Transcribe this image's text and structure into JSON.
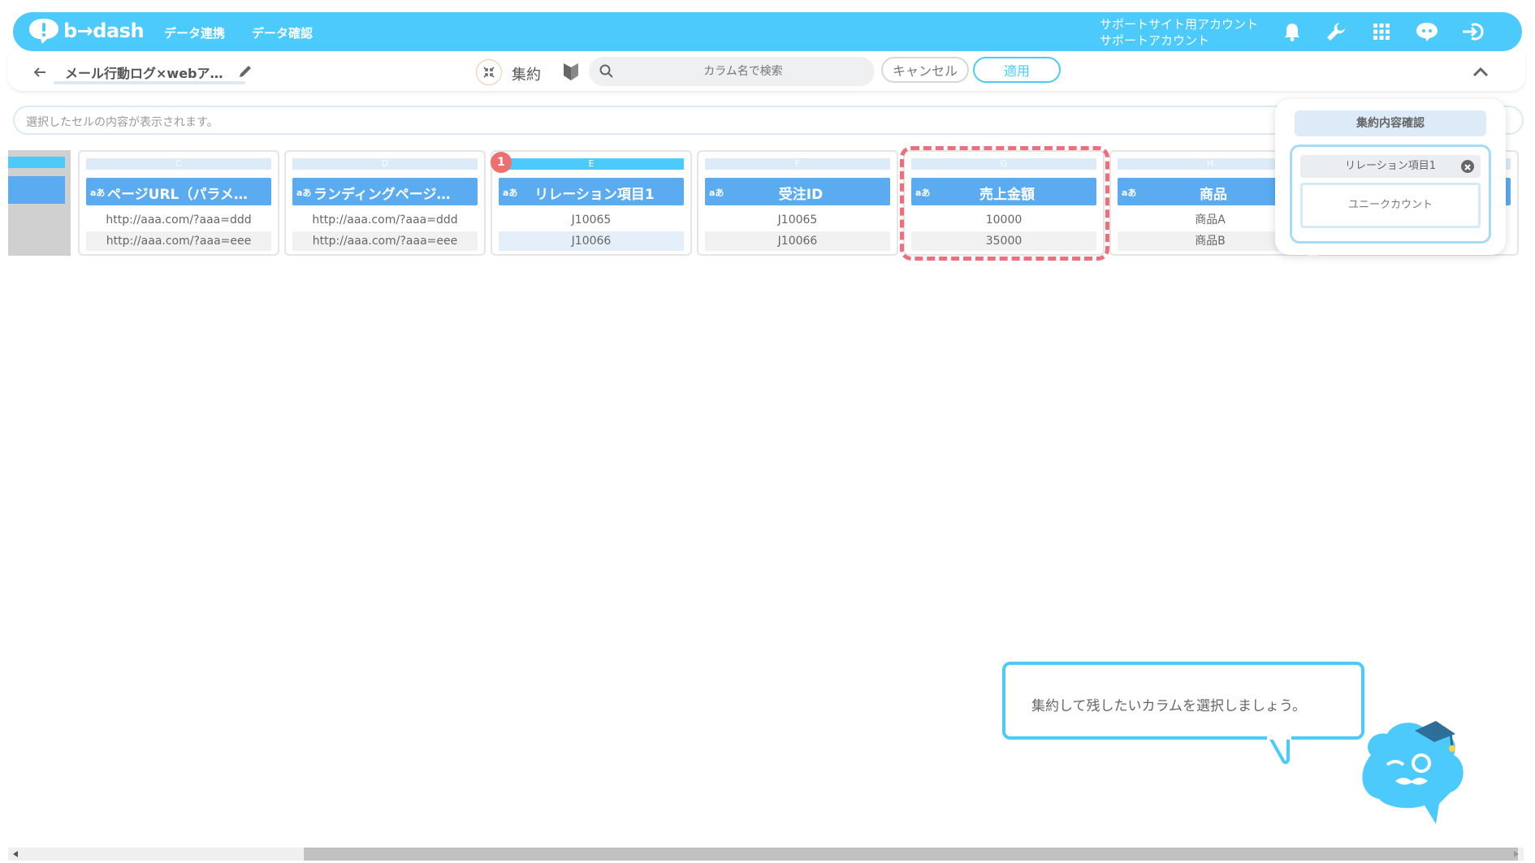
{
  "app": {
    "logo_text": "b→dash",
    "nav": [
      "データ連携",
      "データ確認"
    ],
    "account_line1": "サポートサイト用アカウント",
    "account_line2": "サポートアカウント",
    "icons": [
      "bell-icon",
      "wrench-icon",
      "grid-icon",
      "chat-icon",
      "logout-icon"
    ],
    "accent_color": "#4ccafb"
  },
  "toolbar": {
    "doc_title": "メール行動ログ×webア…",
    "agg_label": "集約",
    "search_placeholder": "カラム名で検索",
    "cancel_label": "キャンセル",
    "apply_label": "適用"
  },
  "cellbar": {
    "placeholder": "選択したセルの内容が表示されます。"
  },
  "grid": {
    "columns": [
      {
        "letter": "C",
        "type": "aあ",
        "name": "ページURL（パラメ…",
        "values": [
          "http://aaa.com/?aaa=ddd",
          "http://aaa.com/?aaa=eee"
        ]
      },
      {
        "letter": "D",
        "type": "aあ",
        "name": "ランディングページ…",
        "values": [
          "http://aaa.com/?aaa=ddd",
          "http://aaa.com/?aaa=eee"
        ]
      },
      {
        "letter": "E",
        "type": "aあ",
        "name": "リレーション項目1",
        "values": [
          "J10065",
          "J10066"
        ],
        "badge": "1"
      },
      {
        "letter": "F",
        "type": "aあ",
        "name": "受注ID",
        "values": [
          "J10065",
          "J10066"
        ]
      },
      {
        "letter": "G",
        "type": "aあ",
        "name": "売上金額",
        "values": [
          "10000",
          "35000"
        ]
      },
      {
        "letter": "H",
        "type": "aあ",
        "name": "商品",
        "values": [
          "商品A",
          "商品B"
        ]
      }
    ]
  },
  "popup": {
    "title": "集約内容確認",
    "chip": "リレーション項目1",
    "mode": "ユニークカウント"
  },
  "tooltip": {
    "text": "集約して残したいカラムを選択しましょう。"
  }
}
